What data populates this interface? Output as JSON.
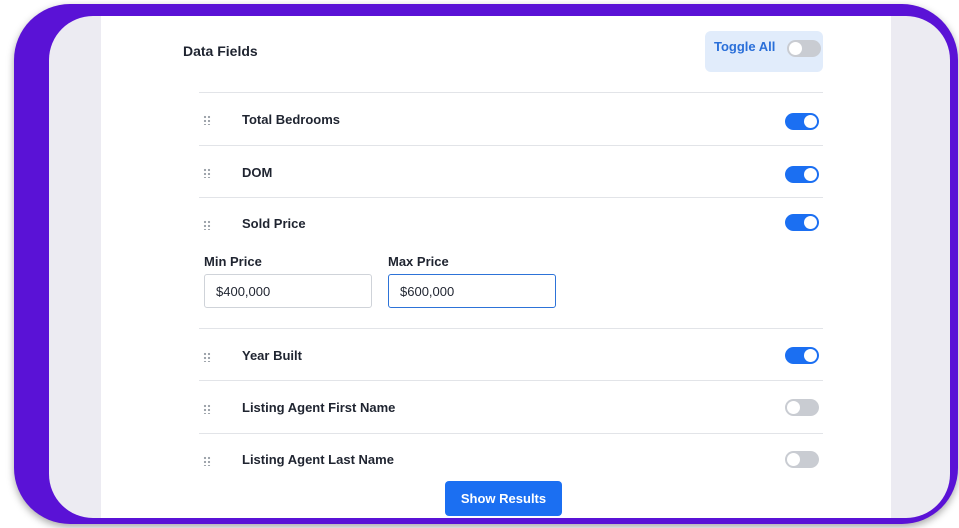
{
  "panel": {
    "title": "Data Fields",
    "toggle_all": {
      "label": "Toggle All",
      "on": false
    }
  },
  "fields": [
    {
      "label": "Total Bedrooms",
      "on": true
    },
    {
      "label": "DOM",
      "on": true
    },
    {
      "label": "Sold Price",
      "on": true
    },
    {
      "label": "Year Built",
      "on": true
    },
    {
      "label": "Listing Agent First Name",
      "on": false
    },
    {
      "label": "Listing Agent Last Name",
      "on": false
    }
  ],
  "sold_price_filter": {
    "min_label": "Min Price",
    "min_value": "$400,000",
    "max_label": "Max Price",
    "max_value": "$600,000"
  },
  "footer": {
    "show_results_label": "Show Results"
  },
  "colors": {
    "frame": "#5a12d6",
    "accent": "#1b6ff2",
    "toggle_off": "#c9ccd2",
    "toggle_all_bg": "#e1ecfb"
  }
}
